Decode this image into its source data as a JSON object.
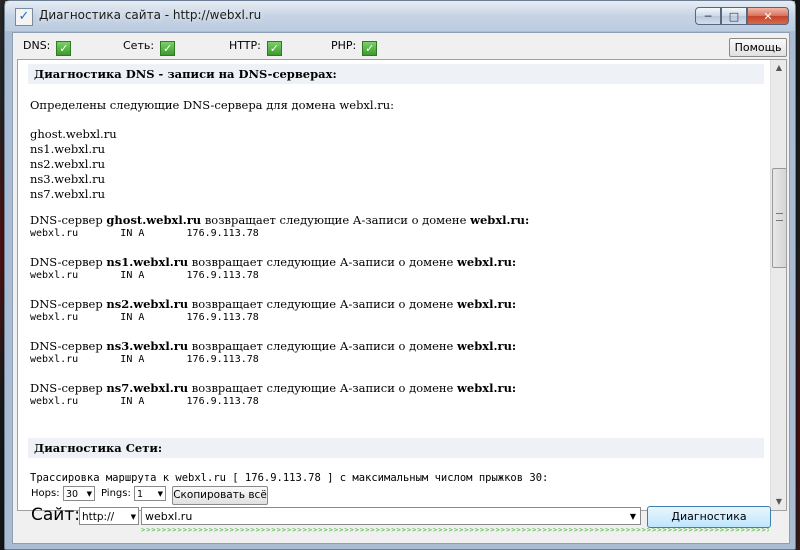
{
  "window": {
    "title": "Диагностика сайта - http://webxl.ru",
    "controls": {
      "minimize": "─",
      "maximize": "□",
      "close": "✕"
    }
  },
  "status": [
    {
      "label": "DNS:",
      "state": "ok"
    },
    {
      "label": "Сеть:",
      "state": "ok"
    },
    {
      "label": "HTTP:",
      "state": "ok"
    },
    {
      "label": "PHP:",
      "state": "ok"
    }
  ],
  "check_glyph": "✓",
  "help_label": "Помощь",
  "report": {
    "dns_header": "Диагностика DNS - записи на DNS-серверах:",
    "dns_intro": "Определены следующие DNS-сервера для домена webxl.ru:",
    "servers": [
      "ghost.webxl.ru",
      "ns1.webxl.ru",
      "ns2.webxl.ru",
      "ns3.webxl.ru",
      "ns7.webxl.ru"
    ],
    "record_prefix": "DNS-сервер",
    "record_middle": "возвращает следующие А-записи о домене",
    "record_domain": "webxl.ru:",
    "record_row": "webxl.ru       IN A       176.9.113.78",
    "net_header": "Диагностика Сети:",
    "trace_line": "Трассировка маршрута к webxl.ru [ 176.9.113.78 ] с максимальным числом прыжков 30:"
  },
  "controls": {
    "hops_label": "Hops:",
    "hops_value": "30",
    "pings_label": "Pings:",
    "pings_value": "1",
    "copy_all": "Скопировать всё",
    "site_label": "Сайт:",
    "protocol": "http://",
    "url": "webxl.ru",
    "diagnose": "Диагностика"
  },
  "progress": 1.0,
  "icons": {
    "dropdown": "chevron-down-icon",
    "status": "check-icon"
  },
  "colors": {
    "ok_green": "#3f9a2e",
    "progress_green": "#3db22b"
  }
}
